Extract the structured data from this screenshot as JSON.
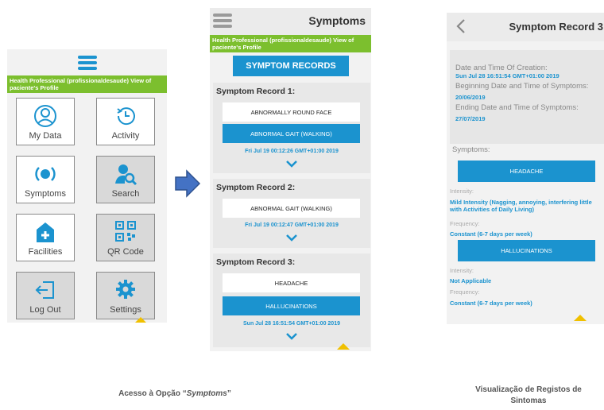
{
  "screen1": {
    "banner": "Health Professional (profissionaldesaude) View of paciente's Profile",
    "tiles": [
      "My Data",
      "Activity",
      "Symptoms",
      "Search",
      "Facilities",
      "QR Code",
      "Log Out",
      "Settings"
    ]
  },
  "screen2": {
    "title": "Symptoms",
    "banner": "Health Professional (profissionaldesaude) View of paciente's Profile",
    "records_button": "SYMPTOM RECORDS",
    "records": [
      {
        "title": "Symptom Record 1:",
        "items": [
          "ABNORMALLY ROUND FACE",
          "ABNORMAL GAIT (WALKING)"
        ],
        "timestamp": "Fri Jul 19 00:12:26 GMT+01:00 2019"
      },
      {
        "title": "Symptom Record 2:",
        "items": [
          "ABNORMAL GAIT (WALKING)"
        ],
        "timestamp": "Fri Jul 19 00:12:47 GMT+01:00 2019"
      },
      {
        "title": "Symptom Record 3:",
        "items": [
          "HEADACHE",
          "HALLUCINATIONS"
        ],
        "timestamp": "Sun Jul 28 16:51:54 GMT+01:00 2019"
      }
    ]
  },
  "screen3": {
    "title": "Symptom Record 3",
    "creation_label": "Date and Time Of Creation:",
    "creation_value": "Sun Jul 28 16:51:54 GMT+01:00 2019",
    "begin_label": "Beginning Date and Time of Symptoms:",
    "begin_value": "20/06/2019",
    "end_label": "Ending Date and Time of Symptoms:",
    "end_value": "27/07/2019",
    "symptoms_label": "Symptoms:",
    "symptoms": [
      {
        "name": "HEADACHE",
        "intensity_label": "Intensity:",
        "intensity": "Mild Intensity (Nagging, annoying, interfering little with Activities of Daily Living)",
        "frequency_label": "Frequency:",
        "frequency": "Constant (6-7 days per week)"
      },
      {
        "name": "HALLUCINATIONS",
        "intensity_label": "Intensity:",
        "intensity": "Not Applicable",
        "frequency_label": "Frequency:",
        "frequency": "Constant (6-7 days per week)"
      }
    ]
  },
  "captions": {
    "left_prefix": "Acesso à Opção “",
    "left_em": "Symptoms",
    "left_suffix": "”",
    "right": "Visualização de Registos de Sintomas"
  },
  "colors": {
    "accent": "#1b93cf",
    "banner": "#7cbf2e",
    "marker": "#f0c000"
  }
}
